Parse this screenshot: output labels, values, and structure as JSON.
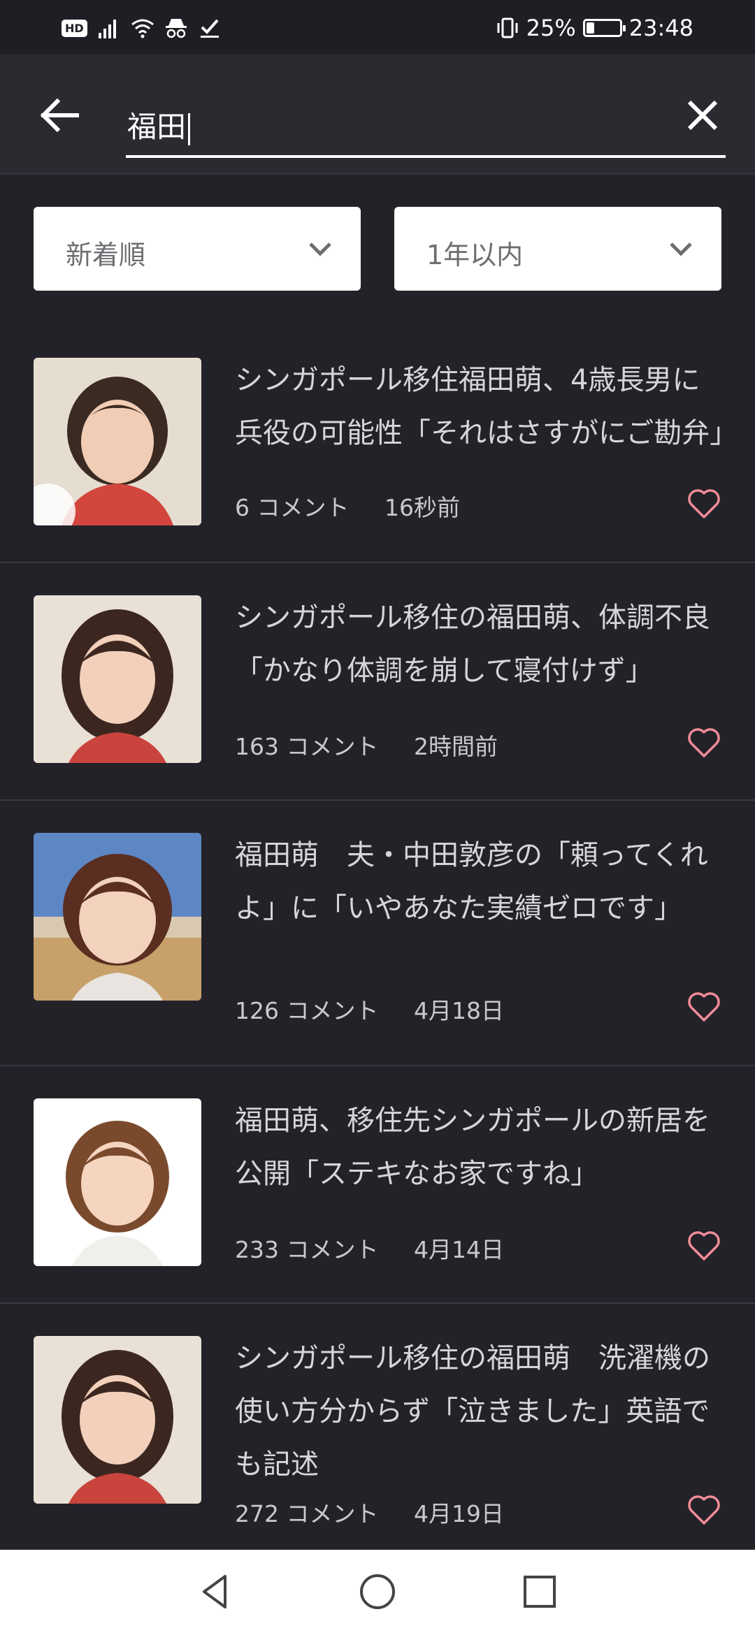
{
  "status_bar": {
    "hd_label": "HD",
    "battery_percent": "25%",
    "time": "23:48",
    "battery_level": 0.25,
    "icons": [
      "hd-icon",
      "signal-icon",
      "wifi-icon",
      "incognito-icon",
      "check-icon",
      "vibrate-icon",
      "battery-icon"
    ]
  },
  "search": {
    "query": "福田"
  },
  "filters": {
    "sort_label": "新着順",
    "period_label": "1年以内"
  },
  "articles": [
    {
      "title": "シンガポール移住福田萌、4歳長男に兵役の可能性「それはさすがにご勘弁」",
      "comments": "6 コメント",
      "time": "16秒前"
    },
    {
      "title": "シンガポール移住の福田萌、体調不良「かなり体調を崩して寝付けず」",
      "comments": "163 コメント",
      "time": "2時間前"
    },
    {
      "title": "福田萌　夫・中田敦彦の「頼ってくれよ」に「いやあなた実績ゼロです」",
      "comments": "126 コメント",
      "time": "4月18日"
    },
    {
      "title": "福田萌、移住先シンガポールの新居を公開「ステキなお家ですね」",
      "comments": "233 コメント",
      "time": "4月14日"
    },
    {
      "title": "シンガポール移住の福田萌　洗濯機の使い方分からず「泣きました」英語でも記述",
      "comments": "272 コメント",
      "time": "4月19日"
    }
  ],
  "colors": {
    "background": "#232229",
    "header": "#2b2a31",
    "heart": "#f08c98",
    "text": "#d6d6da"
  }
}
